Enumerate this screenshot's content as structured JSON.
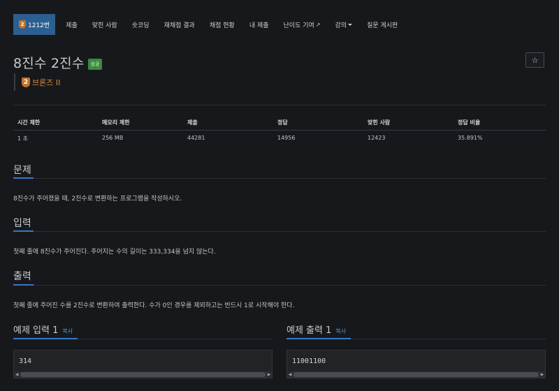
{
  "nav": {
    "active": {
      "tier": "2",
      "label": "1212번"
    },
    "items": [
      "제출",
      "맞힌 사람",
      "숏코딩",
      "재채점 결과",
      "채점 현황",
      "내 제출",
      "난이도 기여",
      "강의",
      "질문 게시판"
    ]
  },
  "problem": {
    "title": "8진수 2진수",
    "status": "성공",
    "tier_icon": "2",
    "tier_label": "브론즈 II",
    "star_icon": "☆"
  },
  "info": {
    "headers": [
      "시간 제한",
      "메모리 제한",
      "제출",
      "정답",
      "맞힌 사람",
      "정답 비율"
    ],
    "values": [
      "1 초",
      "256 MB",
      "44281",
      "14956",
      "12423",
      "35.891%"
    ]
  },
  "sections": {
    "problem": {
      "title": "문제",
      "text": "8진수가 주어졌을 때, 2진수로 변환하는 프로그램을 작성하시오."
    },
    "input": {
      "title": "입력",
      "text": "첫째 줄에 8진수가 주어진다. 주어지는 수의 길이는 333,334을 넘지 않는다."
    },
    "output": {
      "title": "출력",
      "text": "첫째 줄에 주어진 수를 2진수로 변환하여 출력한다. 수가 0인 경우를 제외하고는 반드시 1로 시작해야 한다."
    }
  },
  "examples": {
    "input": {
      "title": "예제 입력 1",
      "copy": "복사",
      "code": "314"
    },
    "output": {
      "title": "예제 출력 1",
      "copy": "복사",
      "code": "11001100"
    }
  },
  "colors": {
    "accent": "#3a78c2",
    "nav_active": "#2b5f8f",
    "success": "#3c8a3e",
    "bronze": "#c2742d"
  }
}
